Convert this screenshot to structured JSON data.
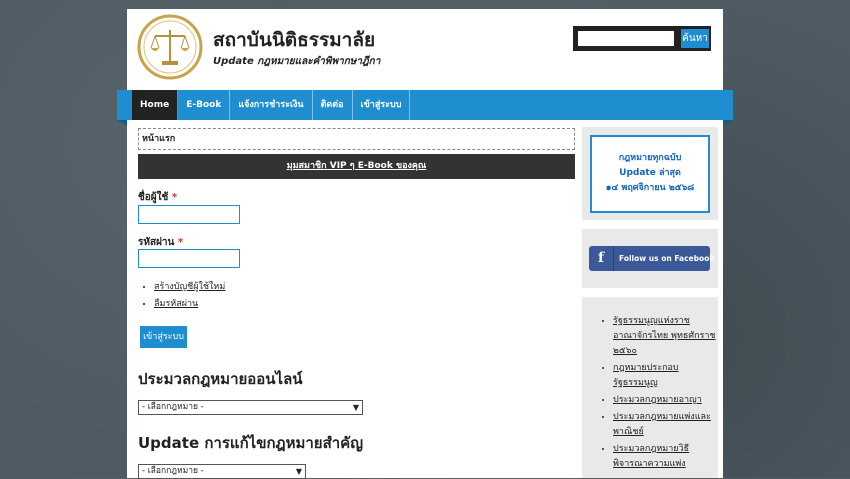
{
  "header": {
    "site_title": "สถาบันนิติธรรมาลัย",
    "tagline": "Update กฎหมายและคำพิพากษาฎีกา",
    "logo_icon": "scales-of-justice-icon",
    "search": {
      "button_label": "ค้นหา",
      "value": ""
    }
  },
  "nav": {
    "items": [
      {
        "label": "Home",
        "active": true
      },
      {
        "label": "E-Book"
      },
      {
        "label": "แจ้งการชำระเงิน"
      },
      {
        "label": "ติดต่อ"
      },
      {
        "label": "เข้าสู่ระบบ"
      }
    ]
  },
  "main": {
    "breadcrumb": "หน้าแรก",
    "vip_banner": "มุมสมาชิก VIP ๆ E-Book ของคุณ",
    "username_label": "ชื่อผู้ใช้",
    "password_label": "รหัสผ่าน",
    "required_mark": "*",
    "links": [
      "สร้างบัญชีผู้ใช้ใหม่",
      "ลืมรหัสผ่าน"
    ],
    "login_button": "เข้าสู่ระบบ",
    "section1_title": "ประมวลกฎหมายออนไลน์",
    "select1_value": "- เลือกกฎหมาย -",
    "section2_title": "Update การแก้ไขกฎหมายสำคัญ",
    "select2_value": "- เลือกกฎหมาย -"
  },
  "sidebar": {
    "update_lines": [
      "กฎหมายทุกฉบับ",
      "Update ล่าสุด",
      "๑๔ พฤศจิกายน ๒๕๖๘"
    ],
    "facebook_label": "Follow us on Facebook",
    "facebook_icon_glyph": "f",
    "list": [
      "รัฐธรรมนูญแห่งราชอาณาจักรไทย พุทธศักราช ๒๕๖๐",
      "กฎหมายประกอบรัฐธรรมนูญ",
      "ประมวลกฎหมายอาญา",
      "ประมวลกฎหมายแพ่งและพาณิชย์",
      "ประมวลกฎหมายวิธีพิจารณาความแพ่ง"
    ]
  },
  "colors": {
    "accent": "#1e8ed1",
    "dark": "#222222",
    "facebook": "#3b5998",
    "required": "#d32f2f"
  }
}
